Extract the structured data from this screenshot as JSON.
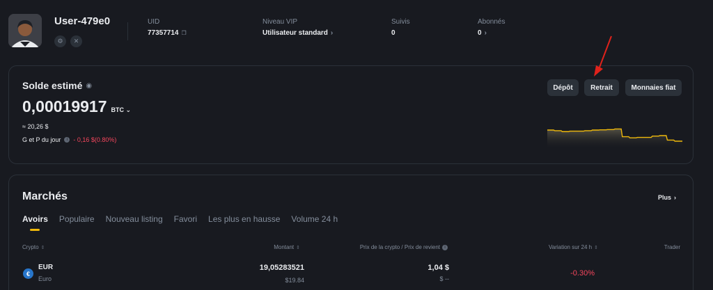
{
  "profile": {
    "username": "User-479e0",
    "uid_label": "UID",
    "uid_value": "77357714",
    "vip_label": "Niveau VIP",
    "vip_value": "Utilisateur standard",
    "following_label": "Suivis",
    "following_value": "0",
    "followers_label": "Abonnés",
    "followers_value": "0"
  },
  "balance": {
    "title": "Solde estimé",
    "amount": "0,00019917",
    "unit": "BTC",
    "fiat": "≈ 20,26 $",
    "pnl_label": "G et P du jour",
    "pnl_value": "- 0,16 $(0.80%)",
    "buttons": {
      "deposit": "Dépôt",
      "withdraw": "Retrait",
      "fiat": "Monnaies fiat"
    },
    "sparkline": [
      0.25,
      0.28,
      0.32,
      0.3,
      0.3,
      0.28,
      0.25,
      0.24,
      0.23,
      0.2,
      0.55,
      0.6,
      0.58,
      0.58,
      0.52,
      0.5,
      0.7,
      0.75,
      0.75
    ]
  },
  "markets": {
    "title": "Marchés",
    "more": "Plus",
    "tabs": [
      "Avoirs",
      "Populaire",
      "Nouveau listing",
      "Favori",
      "Les plus en hausse",
      "Volume 24 h"
    ],
    "columns": {
      "crypto": "Crypto",
      "amount": "Montant",
      "price": "Prix de la crypto / Prix de revient",
      "change": "Variation sur 24 h",
      "trade": "Trader"
    },
    "rows": [
      {
        "symbol": "EUR",
        "name": "Euro",
        "icon": "€",
        "amount": "19,05283521",
        "amount_fiat": "$19.84",
        "price": "1,04 $",
        "cost": "$ --",
        "change": "-0.30%"
      }
    ]
  },
  "colors": {
    "background": "#181a20",
    "accent": "#f0b90b",
    "negative": "#f6465d",
    "annotation": "#e0221b"
  }
}
